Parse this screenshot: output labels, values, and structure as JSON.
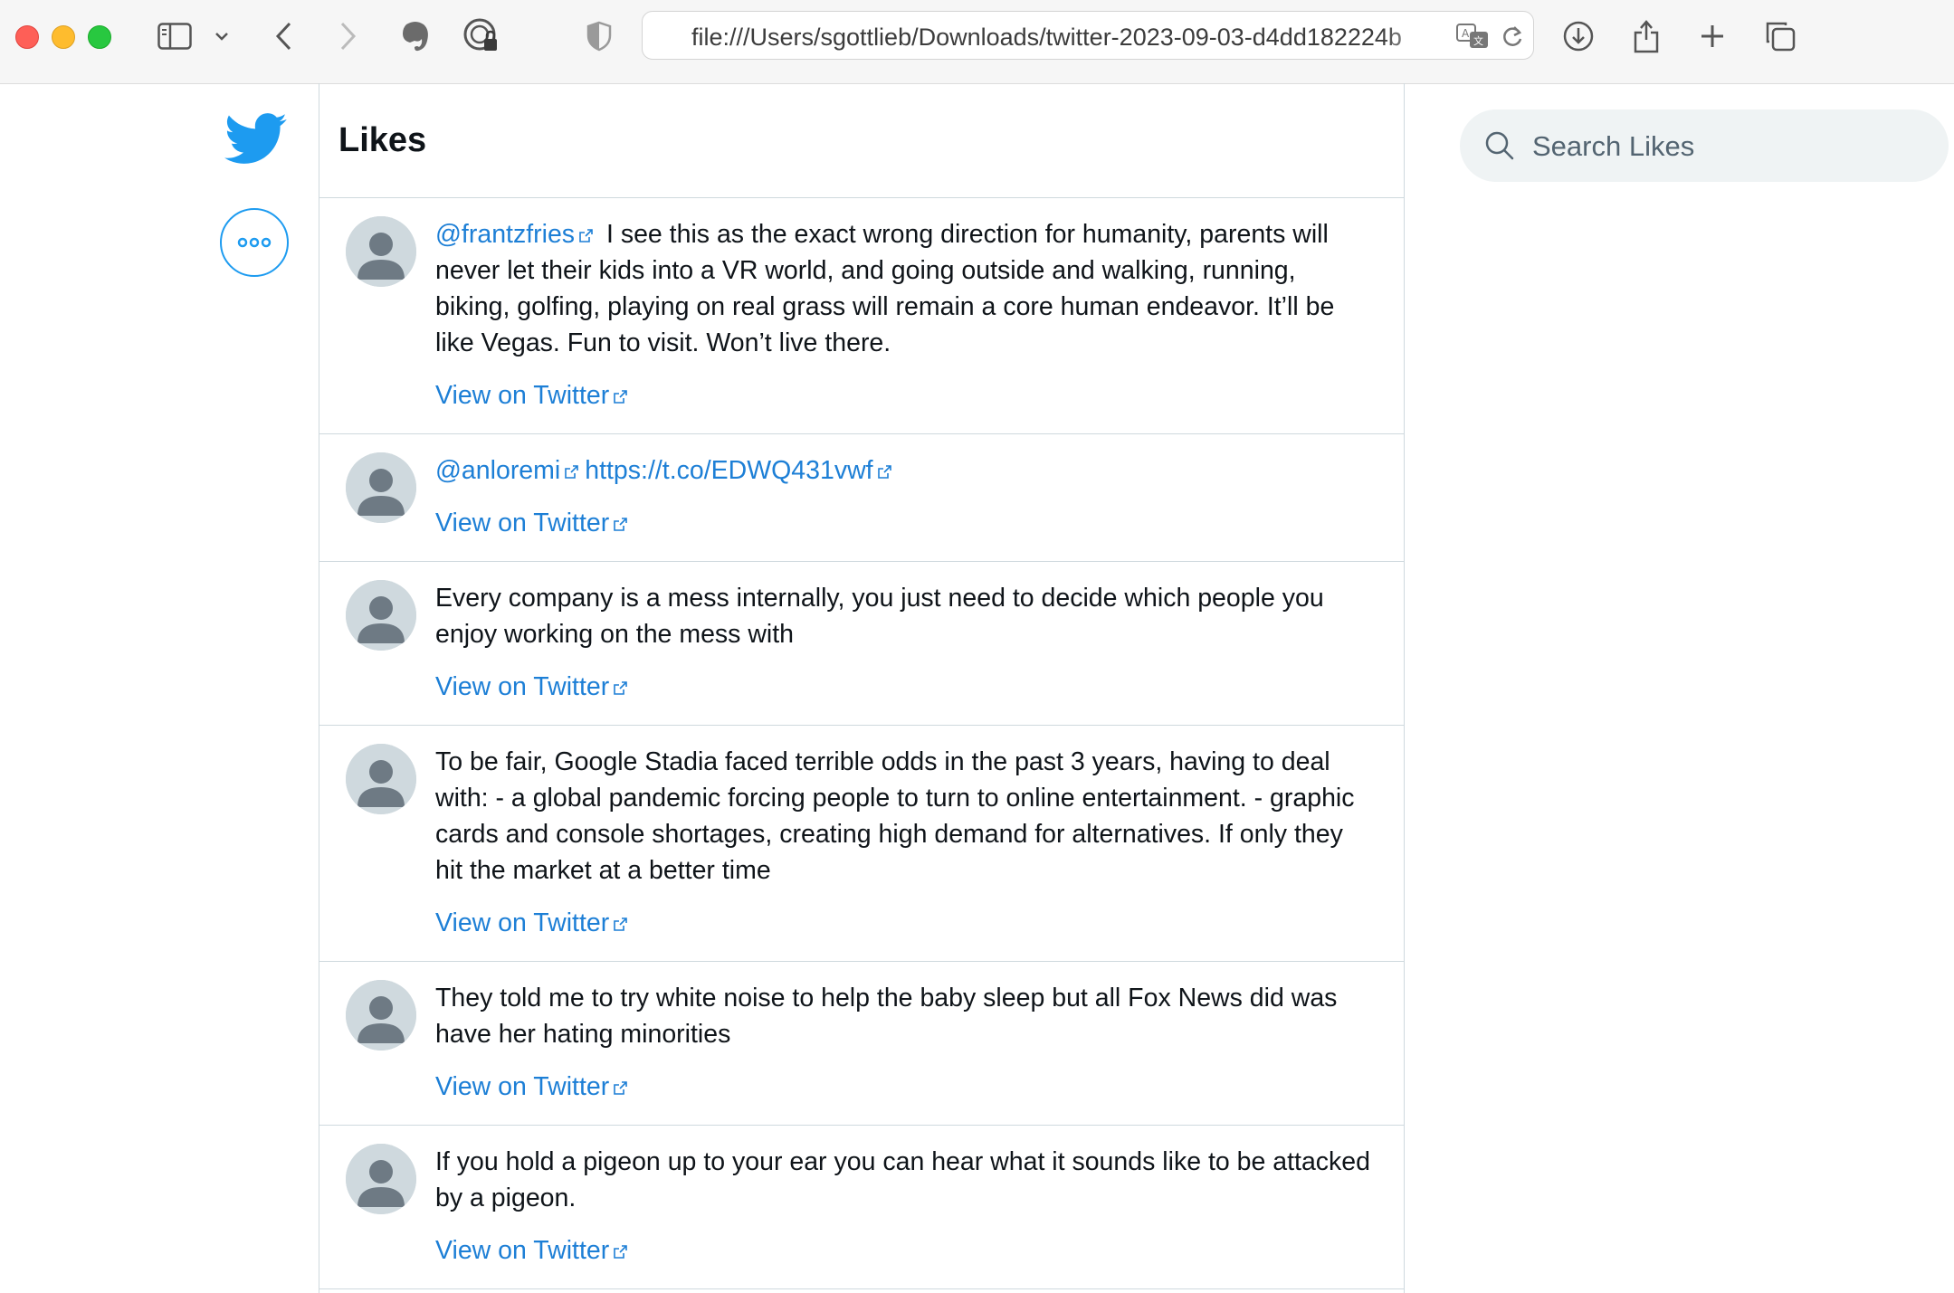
{
  "browser": {
    "url": "file:///Users/sgottlieb/Downloads/twitter-2023-09-03-d4dd182224b"
  },
  "page": {
    "title": "Likes"
  },
  "search": {
    "placeholder": "Search Likes"
  },
  "tweets": [
    {
      "mention": "@frantzfries",
      "text": "I see this as the exact wrong direction for humanity, parents will never let their kids into a VR world, and going outside and walking, running, biking, golfing, playing on real grass will remain a core human endeavor. It’ll be like Vegas. Fun to visit. Won’t live there.",
      "view_label": "View on Twitter"
    },
    {
      "mention": "@anloremi",
      "url_text": "https://t.co/EDWQ431vwf",
      "view_label": "View on Twitter"
    },
    {
      "text": "Every company is a mess internally, you just need to decide which people you enjoy working on the mess with",
      "view_label": "View on Twitter"
    },
    {
      "text": "To be fair, Google Stadia faced terrible odds in the past 3 years, having to deal with: - a global pandemic forcing people to turn to online entertainment. - graphic cards and console shortages, creating high demand for alternatives. If only they hit the market at a better time",
      "view_label": "View on Twitter"
    },
    {
      "text": "They told me to try white noise to help the baby sleep but all Fox News did was have her hating minorities",
      "view_label": "View on Twitter"
    },
    {
      "text": "If you hold a pigeon up to your ear you can hear what it sounds like to be attacked by a pigeon.",
      "view_label": "View on Twitter"
    }
  ]
}
